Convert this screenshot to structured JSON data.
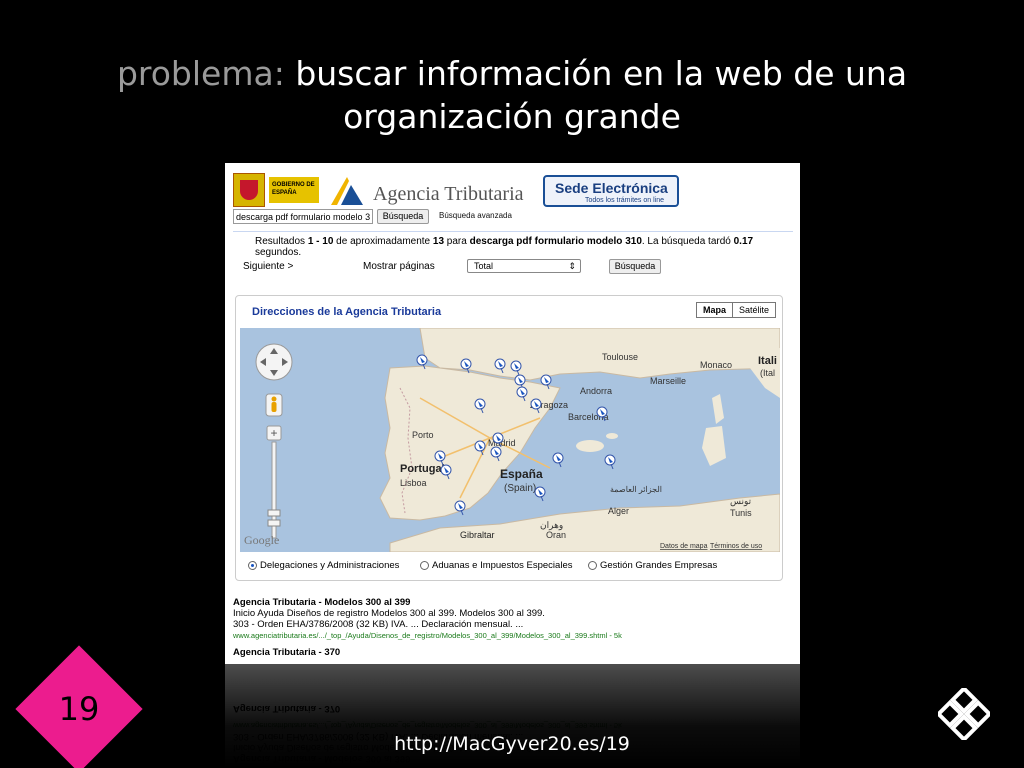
{
  "slide": {
    "title_prefix": "problema:",
    "title_rest": " buscar información en la web de una organización grande",
    "url": "http://MacGyver20.es/19",
    "slide_number": "19",
    "badge_color": "#ec1c8e"
  },
  "screenshot": {
    "header": {
      "gov_label": "GOBIERNO DE ESPAÑA",
      "agency_name": "Agencia Tributaria",
      "sede_title": "Sede Electrónica",
      "sede_subtitle": "Todos los trámites on line"
    },
    "search": {
      "query": "descarga pdf formulario modelo 3",
      "button": "Búsqueda",
      "advanced_link": "Búsqueda avanzada"
    },
    "results_summary": {
      "prefix": "Resultados ",
      "range": "1 - 10",
      "mid1": " de aproximadamente ",
      "count": "13",
      "mid2": " para ",
      "query": "descarga pdf formulario modelo 310",
      "mid3": ". La búsqueda tardó ",
      "time": "0.17",
      "suffix": " segundos."
    },
    "nav": {
      "next": "Siguiente >",
      "show_pages": "Mostrar páginas",
      "select_value": "Total",
      "button": "Búsqueda"
    },
    "map_panel": {
      "title": "Direcciones de la Agencia Tributaria",
      "type_map": "Mapa",
      "type_sat": "Satélite",
      "labels": {
        "spain": "España",
        "spain_en": "(Spain)",
        "portugal": "Portugal",
        "lisboa": "Lisboa",
        "porto": "Porto",
        "toulouse": "Toulouse",
        "marseille": "Marseille",
        "monaco": "Monaco",
        "italia": "Itali",
        "italia2": "(Ital",
        "andorra": "Andorra",
        "barcelona": "Barcelona",
        "zaragoza": "Zaragoza",
        "madrid": "Madrid",
        "gibraltar": "Gibraltar",
        "oran": "Oran",
        "oran_ar": "وهران",
        "alger": "Alger",
        "alger_ar": "الجزائر العاصمة",
        "tunis": "Tunis",
        "tunis_ar": "تونس",
        "google": "Google",
        "copyright_1": "Datos de mapa",
        "copyright_2": "Términos de uso"
      },
      "radios": [
        {
          "label": "Delegaciones y Administraciones",
          "selected": true
        },
        {
          "label": "Aduanas e Impuestos Especiales",
          "selected": false
        },
        {
          "label": "Gestión Grandes Empresas",
          "selected": false
        }
      ]
    },
    "results": [
      {
        "title": "Agencia Tributaria - Modelos 300 al 399",
        "line1": "Inicio Ayuda Diseños de registro Modelos 300 al 399. Modelos 300 al 399.",
        "line2": "303 - Orden EHA/3786/2008 (32 KB) IVA. ... Declaración mensual. ...",
        "url": "www.agenciatributaria.es/.../_top_/Ayuda/Disenos_de_registro/Modelos_300_al_399/Modelos_300_al_399.shtml - 5k"
      },
      {
        "title": "Agencia Tributaria - 370"
      }
    ]
  },
  "colors": {
    "accent_blue": "#1a3a9a",
    "sea": "#a9c3df",
    "land": "#efe9d8"
  },
  "icons": [
    "pan-control-icon",
    "pegman-icon",
    "zoom-in-icon",
    "map-pin-icon",
    "macgyver-logo-icon"
  ]
}
